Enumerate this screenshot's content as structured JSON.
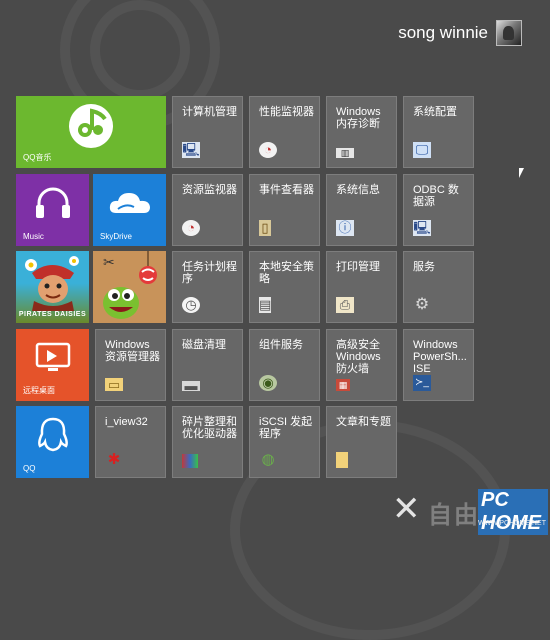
{
  "user": {
    "name": "song winnie"
  },
  "apps": {
    "qq_music": "QQ音乐",
    "music": "Music",
    "skydrive": "SkyDrive",
    "remote_desktop": "远程桌面",
    "qq": "QQ",
    "pirates_label": "PIRATES DAISIES"
  },
  "admin_tiles": {
    "computer_mgmt": "计算机管理",
    "perf_monitor": "性能监视器",
    "mem_diag": "Windows\n内存诊断",
    "sys_config": "系统配置",
    "res_monitor": "资源监视器",
    "event_viewer": "事件查看器",
    "sys_info": "系统信息",
    "odbc": "ODBC 数\n据源",
    "task_scheduler": "任务计划程\n序",
    "local_security": "本地安全策\n略",
    "print_mgmt": "打印管理",
    "services": "服务",
    "explorer": "Windows\n资源管理器",
    "disk_cleanup": "磁盘清理",
    "component_services": "组件服务",
    "firewall": "高级安全\nWindows\n防火墙",
    "powershell_ise": "Windows\nPowerSh...\nISE",
    "iview": "i_view32",
    "defrag": "碎片整理和\n优化驱动器",
    "iscsi": "iSCSI 发起\n程序",
    "topics": "文章和专题"
  },
  "watermark": {
    "brand_cn": "自由互联",
    "logo": "PC HOME",
    "url": "WWW.PCHOME.NET"
  },
  "colors": {
    "background": "#4a4a4a",
    "admin_tile": "#676767",
    "qq_music": "#6cb82f",
    "music": "#7e30a6",
    "skydrive": "#1c80d8",
    "remote_desktop": "#e5532a",
    "qq": "#1c80d8"
  }
}
